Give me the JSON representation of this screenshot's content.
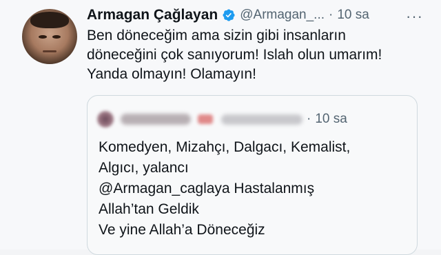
{
  "tweet": {
    "author_name": "Armagan Çağlayan",
    "handle": "@Armagan_...",
    "separator": "·",
    "time": "10 sa",
    "more_label": "···",
    "text_lines": [
      "Ben döneceğim ama sizin gibi insanların",
      "döneceğini çok sanıyorum! Islah olun umarım!",
      "Yanda olmayın! Olamayın!"
    ]
  },
  "quoted_tweet": {
    "separator": "·",
    "time": "10 sa",
    "text_lines": [
      "Komedyen, Mizahçı, Dalgacı, Kemalist,",
      "Algıcı, yalancı",
      "@Armagan_caglaya Hastalanmış",
      "Allah’tan Geldik",
      "Ve yine Allah’a Döneceğiz"
    ]
  },
  "colors": {
    "text_primary": "#0f1419",
    "text_secondary": "#536471",
    "verified_blue": "#1d9bf0",
    "border": "#cfd9de"
  },
  "icons": {
    "verified": "verified-badge-icon",
    "more": "more-options-icon"
  }
}
